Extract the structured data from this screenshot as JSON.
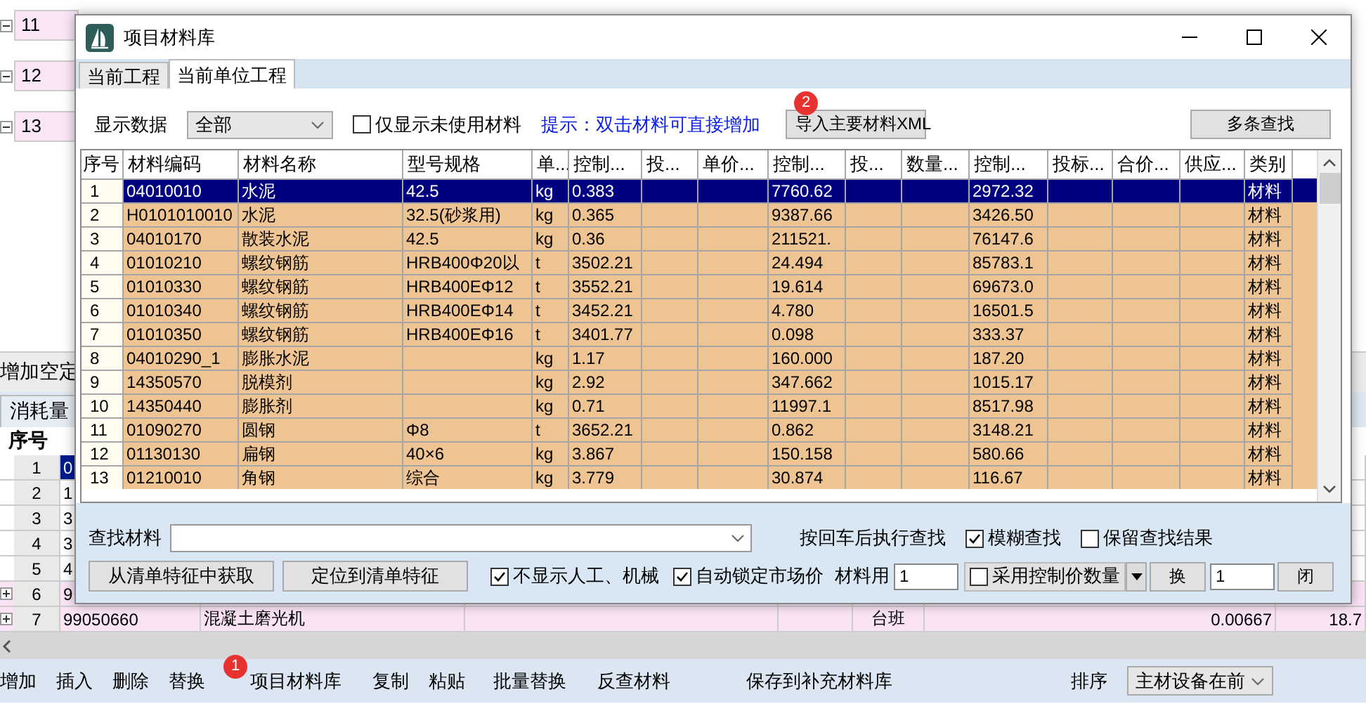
{
  "background": {
    "tree_items": [
      {
        "label": "11",
        "expanded": true
      },
      {
        "label": "12",
        "expanded": true
      },
      {
        "label": "13",
        "expanded": true
      }
    ],
    "toolbar_label": "增加空定",
    "tab": "消耗量",
    "table": {
      "columns": [
        "序号"
      ],
      "rows": [
        {
          "seq": "1",
          "code": "0",
          "selected": true
        },
        {
          "seq": "2",
          "code": "1",
          "selected": false
        },
        {
          "seq": "3",
          "code": "3",
          "selected": false
        },
        {
          "seq": "4",
          "code": "3",
          "selected": false
        },
        {
          "seq": "5",
          "code": "4",
          "selected": false
        },
        {
          "seq": "6",
          "code": "9",
          "selected": false,
          "expanded": false
        },
        {
          "seq": "7",
          "code": "99050660",
          "name": "混凝土磨光机",
          "unit": "台班",
          "quantity": "0.00667",
          "column_8": "18.7",
          "selected": false,
          "expanded": false
        }
      ]
    }
  },
  "toolbar": {
    "items": [
      {
        "label": "增加"
      },
      {
        "label": "插入"
      },
      {
        "label": "删除"
      },
      {
        "label": "替换"
      },
      {
        "label": "项目材料库",
        "badge": "1"
      },
      {
        "label": "复制"
      },
      {
        "label": "粘贴"
      },
      {
        "label": "批量替换"
      },
      {
        "label": "反查材料"
      },
      {
        "label": "保存到补充材料库"
      }
    ],
    "sort_label": "排序",
    "sort_value": "主材设备在前"
  },
  "dialog": {
    "title": "项目材料库",
    "tabs": [
      {
        "label": "当前工程",
        "selected": false
      },
      {
        "label": "当前单位工程",
        "selected": true
      }
    ],
    "display_label": "显示数据",
    "display_value": "全部",
    "unused_only": {
      "label": "仅显示未使用材料",
      "checked": false
    },
    "hint": "提示：双击材料可直接增加",
    "import_button": {
      "label": "导入主要材料XML",
      "badge": "2"
    },
    "multi_search_button": "多条查找",
    "table": {
      "columns": [
        "序号",
        "材料编码",
        "材料名称",
        "型号规格",
        "单...",
        "控制...",
        "投...",
        "单价...",
        "控制...",
        "投...",
        "数量...",
        "控制...",
        "投标...",
        "合价...",
        "供应...",
        "类别"
      ],
      "rows": [
        {
          "seq": "1",
          "code": "04010010",
          "name": "水泥",
          "spec": "42.5",
          "unit": "kg",
          "control_price": "0.383",
          "control_qty": "7760.62",
          "control_total": "2972.32",
          "category": "材料",
          "selected": true
        },
        {
          "seq": "2",
          "code": "H0101010010",
          "name": "水泥",
          "spec": "32.5(砂浆用)",
          "unit": "kg",
          "control_price": "0.365",
          "control_qty": "9387.66",
          "control_total": "3426.50",
          "category": "材料",
          "selected": false
        },
        {
          "seq": "3",
          "code": "04010170",
          "name": "散装水泥",
          "spec": "42.5",
          "unit": "kg",
          "control_price": "0.36",
          "control_qty": "211521.",
          "control_total": "76147.6",
          "category": "材料",
          "selected": false
        },
        {
          "seq": "4",
          "code": "01010210",
          "name": "螺纹钢筋",
          "spec": "HRB400Φ20以",
          "unit": "t",
          "control_price": "3502.21",
          "control_qty": "24.494",
          "control_total": "85783.1",
          "category": "材料",
          "selected": false
        },
        {
          "seq": "5",
          "code": "01010330",
          "name": "螺纹钢筋",
          "spec": "HRB400EΦ12",
          "unit": "t",
          "control_price": "3552.21",
          "control_qty": "19.614",
          "control_total": "69673.0",
          "category": "材料",
          "selected": false
        },
        {
          "seq": "6",
          "code": "01010340",
          "name": "螺纹钢筋",
          "spec": "HRB400EΦ14",
          "unit": "t",
          "control_price": "3452.21",
          "control_qty": "4.780",
          "control_total": "16501.5",
          "category": "材料",
          "selected": false
        },
        {
          "seq": "7",
          "code": "01010350",
          "name": "螺纹钢筋",
          "spec": "HRB400EΦ16",
          "unit": "t",
          "control_price": "3401.77",
          "control_qty": "0.098",
          "control_total": "333.37",
          "category": "材料",
          "selected": false
        },
        {
          "seq": "8",
          "code": "04010290_1",
          "name": "膨胀水泥",
          "unit": "kg",
          "control_price": "1.17",
          "control_qty": "160.000",
          "control_total": "187.20",
          "category": "材料",
          "selected": false
        },
        {
          "seq": "9",
          "code": "14350570",
          "name": "脱模剂",
          "unit": "kg",
          "control_price": "2.92",
          "control_qty": "347.662",
          "control_total": "1015.17",
          "category": "材料",
          "selected": false
        },
        {
          "seq": "10",
          "code": "14350440",
          "name": "膨胀剂",
          "unit": "kg",
          "control_price": "0.71",
          "control_qty": "11997.1",
          "control_total": "8517.98",
          "category": "材料",
          "selected": false
        },
        {
          "seq": "11",
          "code": "01090270",
          "name": "圆钢",
          "spec": "Φ8",
          "unit": "t",
          "control_price": "3652.21",
          "control_qty": "0.862",
          "control_total": "3148.21",
          "category": "材料",
          "selected": false
        },
        {
          "seq": "12",
          "code": "01130130",
          "name": "扁钢",
          "spec": "40×6",
          "unit": "kg",
          "control_price": "3.867",
          "control_qty": "150.158",
          "control_total": "580.66",
          "category": "材料",
          "selected": false
        },
        {
          "seq": "13",
          "code": "01210010",
          "name": "角钢",
          "spec": "综合",
          "unit": "kg",
          "control_price": "3.779",
          "control_qty": "30.874",
          "control_total": "116.67",
          "category": "材料",
          "selected": false
        }
      ]
    },
    "search": {
      "label": "查找材料",
      "enter_hint": "按回车后执行查找",
      "fuzzy": {
        "label": "模糊查找",
        "checked": true
      },
      "keep": {
        "label": "保留查找结果",
        "checked": false
      }
    },
    "actions": {
      "get_button": "从清单特征中获取",
      "locate_button": "定位到清单特征",
      "hide_labor": {
        "label": "不显示人工、机械",
        "checked": true
      },
      "lock_price": {
        "label": "自动锁定市场价",
        "checked": true
      },
      "usage_label": "材料用",
      "usage_value": "1",
      "use_control": {
        "label": "采用控制价数量",
        "checked": false
      },
      "replace_button": "换",
      "count_value": "1",
      "close_button": "闭"
    }
  }
}
